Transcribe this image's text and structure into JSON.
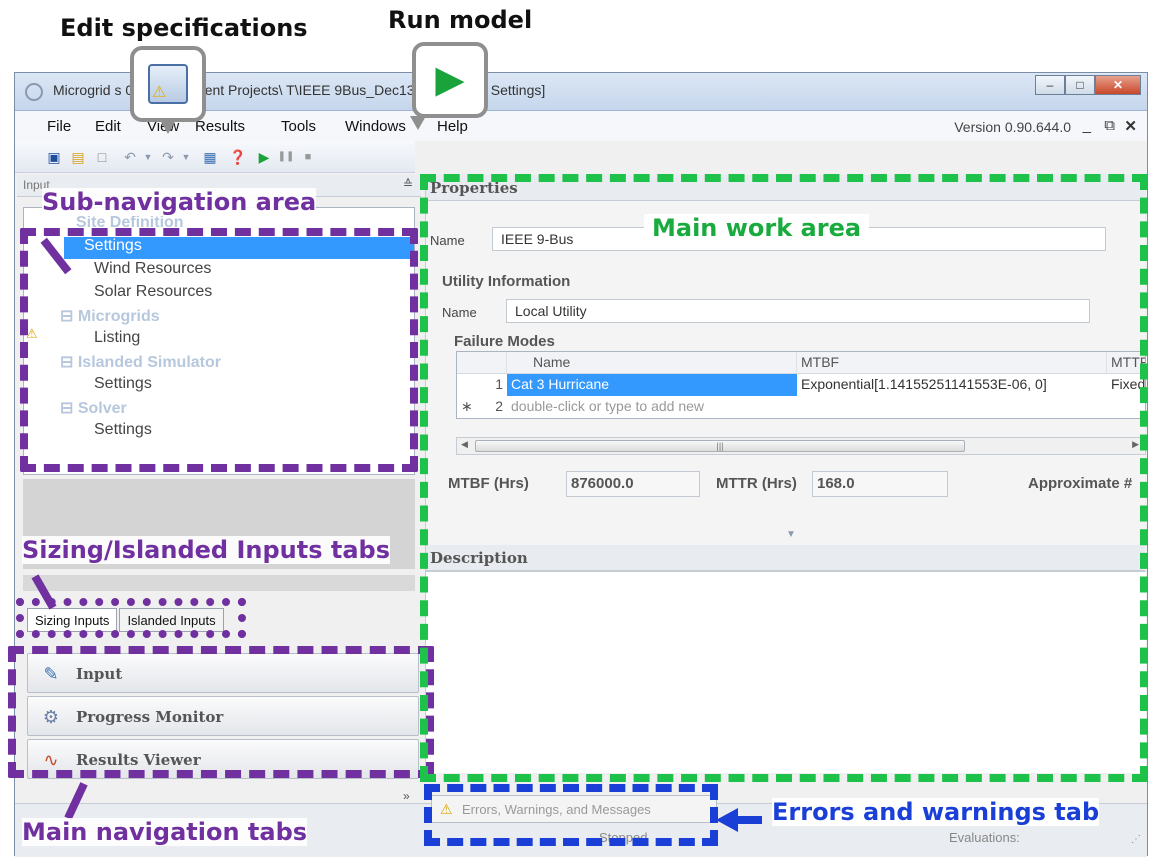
{
  "annotations": {
    "edit_specifications": "Edit specifications",
    "run_model": "Run model",
    "sub_navigation_area": "Sub-navigation area",
    "main_work_area": "Main work area",
    "sizing_islanded_tabs": "Sizing/Islanded Inputs tabs",
    "main_navigation_tabs": "Main navigation tabs",
    "errors_warnings_tab": "Errors and warnings tab"
  },
  "window": {
    "title": "Microgrid        s 0.90 (Z:\\Current Projects\\          T\\IEEE 9Bus_Dec13.mbf) - [Site Settings]",
    "version": "Version 0.90.644.0"
  },
  "menu": [
    "File",
    "Edit",
    "View",
    "Results",
    "Tools",
    "Windows",
    "Help"
  ],
  "left_panel": {
    "header": "Input",
    "tree": [
      {
        "label": "Site Definition",
        "level": 0
      },
      {
        "label": "Settings",
        "level": 1,
        "selected": true
      },
      {
        "label": "Wind Resources",
        "level": 1
      },
      {
        "label": "Solar Resources",
        "level": 1
      },
      {
        "label": "Microgrids",
        "level": 0
      },
      {
        "label": "Listing",
        "level": 1
      },
      {
        "label": "Islanded Simulator",
        "level": 0
      },
      {
        "label": "Settings",
        "level": 1
      },
      {
        "label": "Solver",
        "level": 0
      },
      {
        "label": "Settings",
        "level": 1
      }
    ],
    "tabs": [
      "Sizing Inputs",
      "Islanded Inputs"
    ],
    "nav_buttons": [
      "Input",
      "Progress Monitor",
      "Results Viewer"
    ]
  },
  "properties": {
    "header": "Properties",
    "name_label": "Name",
    "name_value": "IEEE 9-Bus",
    "utility_section": "Utility Information",
    "utility_name_label": "Name",
    "utility_name_value": "Local Utility",
    "failure_modes": "Failure Modes",
    "columns": [
      "Name",
      "MTBF",
      "MTTF"
    ],
    "rows": [
      {
        "num": "1",
        "name": "Cat 3 Hurricane",
        "mtbf": "Exponential[1.14155251141553E-06, 0]",
        "mttf": "Fixed"
      },
      {
        "num": "2",
        "name": "double-click or type to add new",
        "mtbf": "",
        "mttf": ""
      }
    ],
    "mtbf_label": "MTBF (Hrs)",
    "mtbf_value": "876000.0",
    "mttr_label": "MTTR (Hrs)",
    "mttr_value": "168.0",
    "approx_label": "Approximate #"
  },
  "description": {
    "header": "Description"
  },
  "status": {
    "errors_tab": "Errors, Warnings, and Messages",
    "stopped": "Stopped",
    "evaluations": "Evaluations:"
  }
}
